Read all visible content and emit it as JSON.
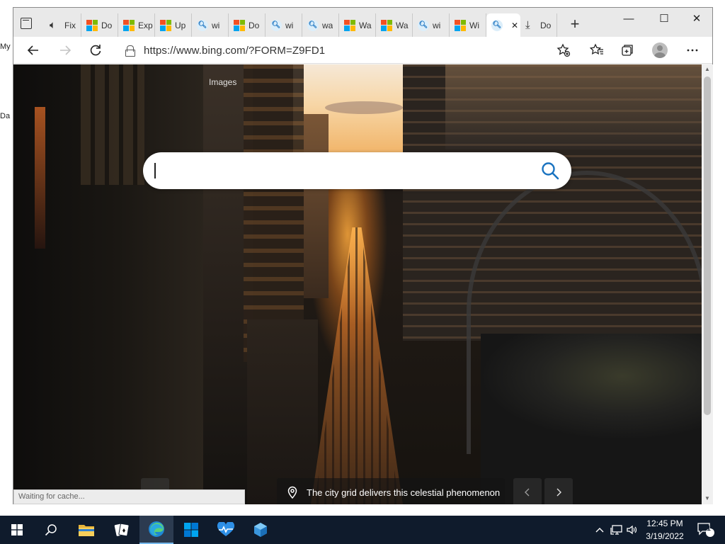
{
  "desktop": {
    "labels": [
      "My",
      "Da"
    ]
  },
  "window": {
    "tabs": [
      {
        "icon": "speaker-icon",
        "label": "Fix"
      },
      {
        "icon": "microsoft-logo-icon",
        "label": "Do"
      },
      {
        "icon": "microsoft-logo-icon",
        "label": "Exp"
      },
      {
        "icon": "microsoft-logo-icon",
        "label": "Up"
      },
      {
        "icon": "search-favicon-icon",
        "label": "wi"
      },
      {
        "icon": "microsoft-logo-icon",
        "label": "Do"
      },
      {
        "icon": "search-favicon-icon",
        "label": "wi"
      },
      {
        "icon": "search-favicon-icon",
        "label": "wa"
      },
      {
        "icon": "microsoft-logo-icon",
        "label": "Wa"
      },
      {
        "icon": "microsoft-logo-icon",
        "label": "Wa"
      },
      {
        "icon": "search-favicon-icon",
        "label": "wi"
      },
      {
        "icon": "microsoft-logo-icon",
        "label": "Wi"
      },
      {
        "icon": "search-favicon-icon",
        "label": "",
        "active": true
      },
      {
        "icon": "download-icon",
        "label": "Do"
      }
    ],
    "controls": {
      "minimize": "—",
      "maximize": "☐",
      "close": "✕"
    }
  },
  "toolbar": {
    "url": "https://www.bing.com/?FORM=Z9FD1",
    "icons": [
      "back-icon",
      "forward-icon",
      "refresh-icon",
      "lock-icon",
      "add-favorite-icon",
      "favorites-icon",
      "collections-icon",
      "profile-avatar",
      "more-icon"
    ]
  },
  "page": {
    "images_link": "Images",
    "search": {
      "value": "",
      "placeholder": ""
    },
    "caption": "The city grid delivers this celestial phenomenon",
    "status": "Waiting for cache..."
  },
  "taskbar": {
    "apps": [
      "start-icon",
      "search-icon",
      "file-explorer-icon",
      "solitaire-icon",
      "edge-icon",
      "store-icon",
      "activity-icon",
      "azure-icon"
    ],
    "active_app": "edge-icon",
    "clock": {
      "time": "12:45 PM",
      "date": "3/19/2022"
    },
    "notification_count": "1"
  },
  "colors": {
    "taskbar": "#0f1b2c",
    "bing_search_icon": "#1a73c0",
    "microsoft_red": "#f25022",
    "microsoft_green": "#7fba00",
    "microsoft_blue": "#00a4ef",
    "microsoft_yellow": "#ffb900"
  }
}
